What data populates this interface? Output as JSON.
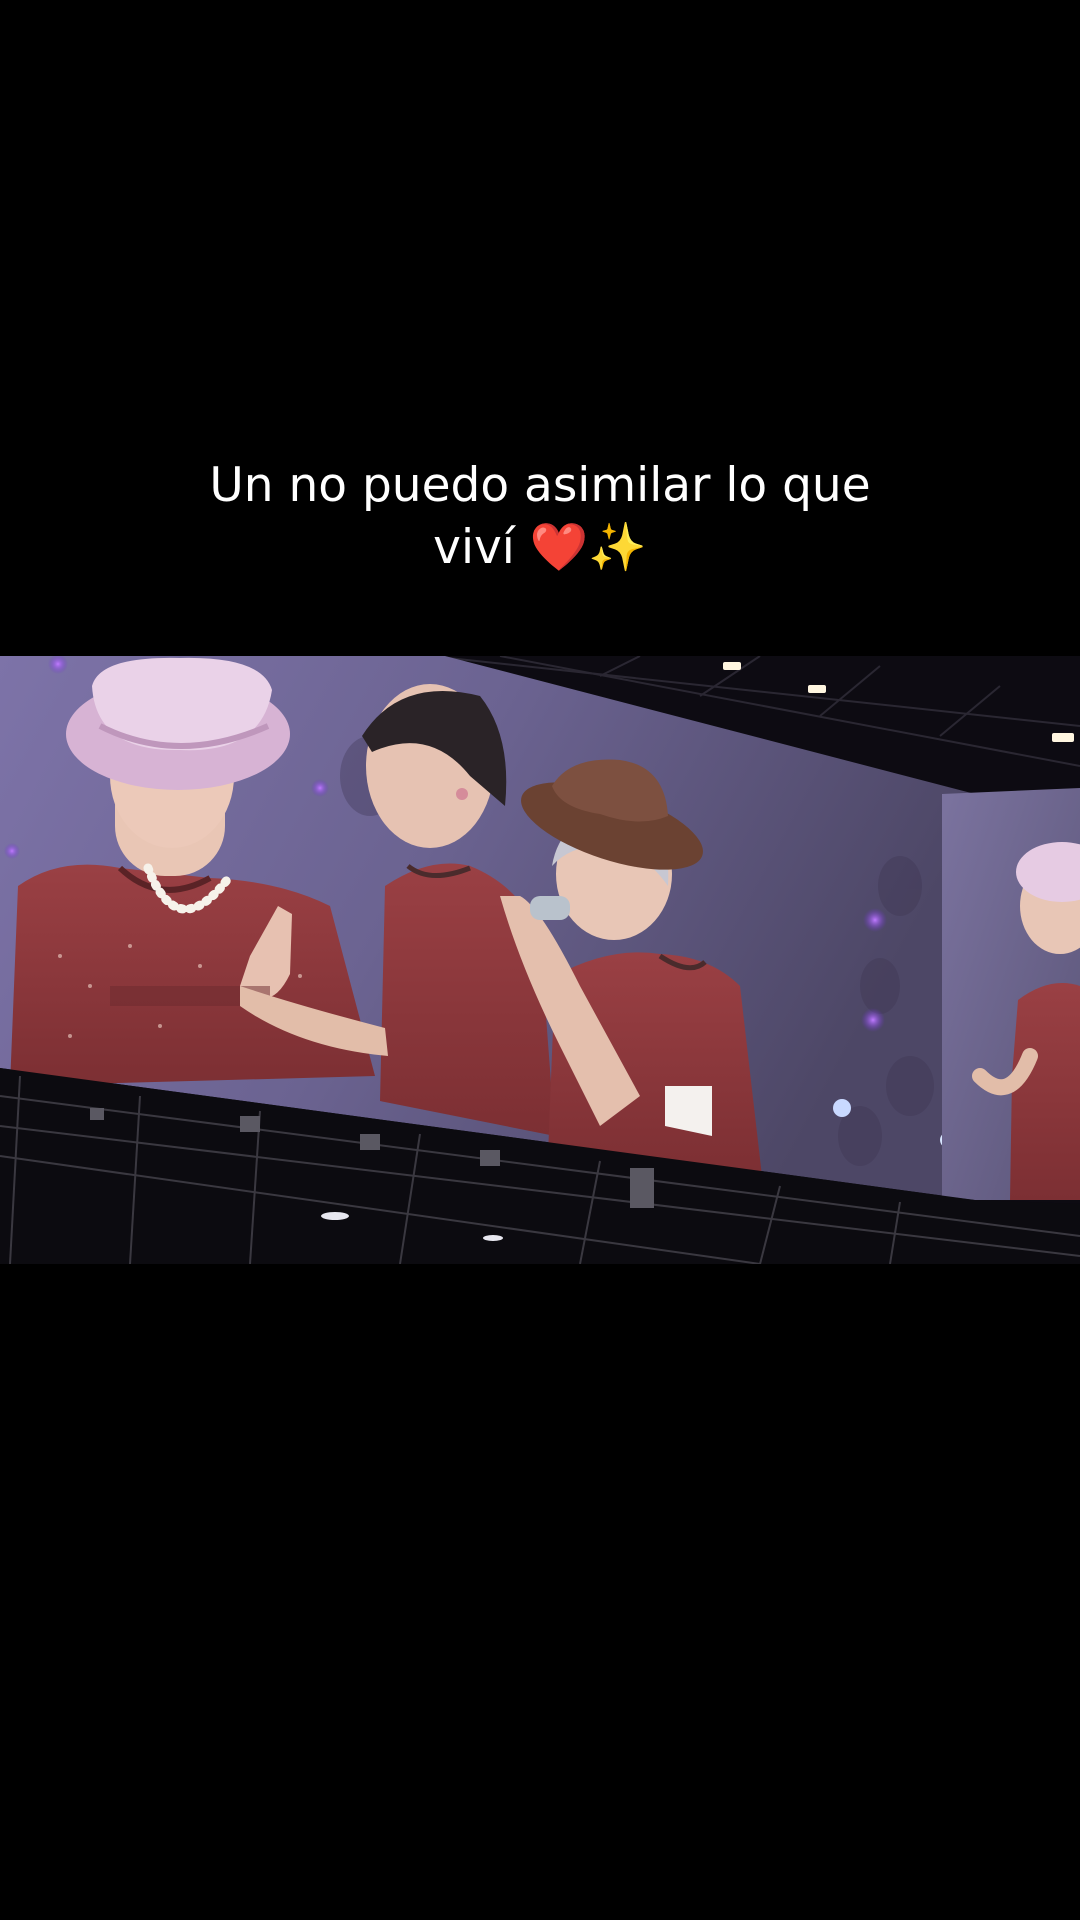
{
  "caption": {
    "line1": "Un no puedo asimilar lo que",
    "line2": "viví ❤️✨"
  },
  "colors": {
    "background": "#000000",
    "caption_text": "#ffffff",
    "screen_glow": "#8c7cb4",
    "shirt_red": "#8e3a3c",
    "hat_pink": "#d9b6d6",
    "hat_brown": "#6b4232"
  }
}
